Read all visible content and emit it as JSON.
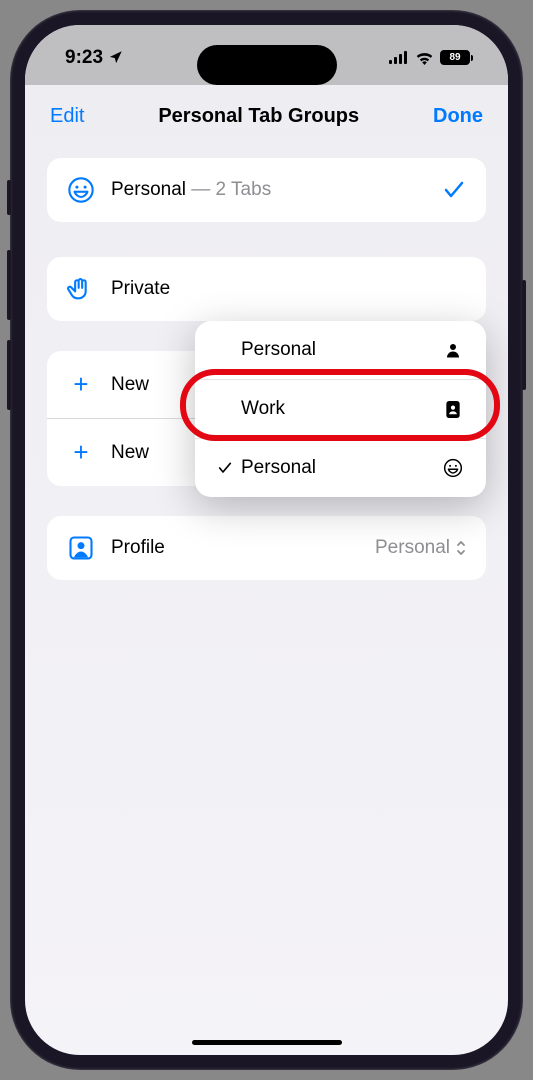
{
  "status": {
    "time": "9:23",
    "battery": "89"
  },
  "nav": {
    "edit": "Edit",
    "title": "Personal Tab Groups",
    "done": "Done"
  },
  "rows": {
    "personal_label": "Personal",
    "personal_count": " — 2 Tabs",
    "private_label": "Private",
    "new1": "New",
    "new2": "New",
    "profile_label": "Profile",
    "profile_value": "Personal"
  },
  "popover": {
    "item1": "Personal",
    "item2": "Work",
    "item3": "Personal"
  }
}
